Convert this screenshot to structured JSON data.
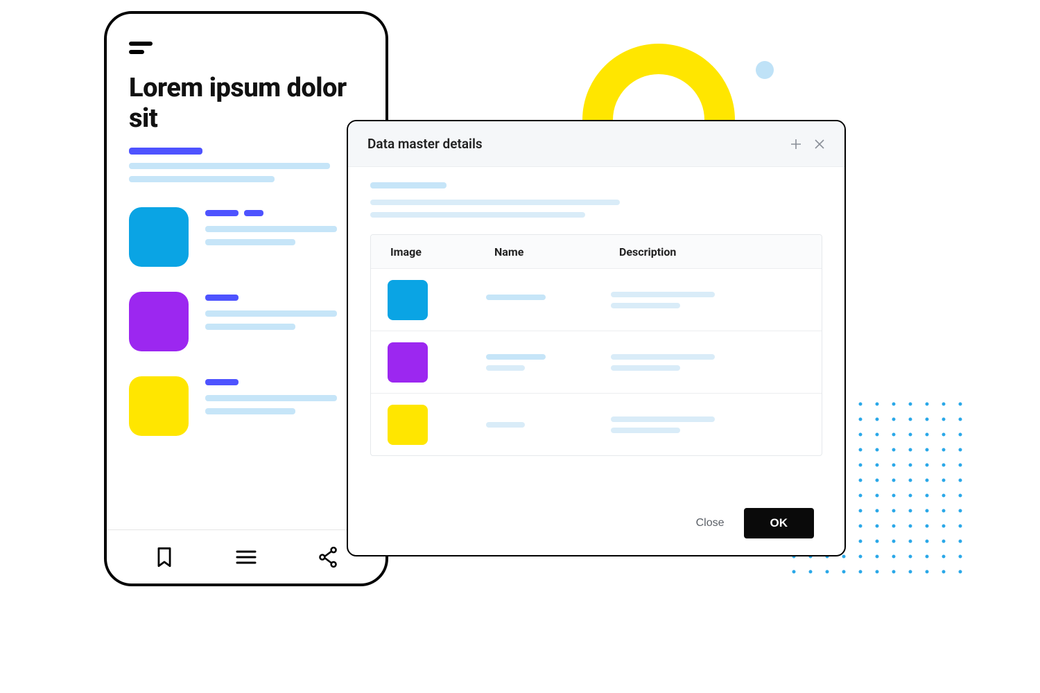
{
  "phone": {
    "headline": "Lorem ipsum dolor sit",
    "items": [
      {
        "color": "blue"
      },
      {
        "color": "purple"
      },
      {
        "color": "yellow"
      }
    ]
  },
  "dialog": {
    "title": "Data master details",
    "columns": {
      "image": "Image",
      "name": "Name",
      "description": "Description"
    },
    "rows": [
      {
        "color": "blue"
      },
      {
        "color": "purple"
      },
      {
        "color": "yellow"
      }
    ],
    "buttons": {
      "close": "Close",
      "ok": "OK"
    }
  }
}
